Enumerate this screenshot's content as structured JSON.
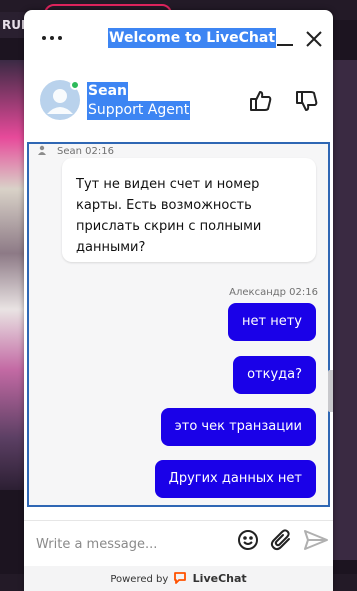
{
  "background": {
    "currency_label": "RUB"
  },
  "widget": {
    "title": "Welcome to LiveChat",
    "agent": {
      "name": "Sean",
      "role": "Support Agent",
      "status_color": "#2dba5a"
    },
    "messages": [
      {
        "sender": "Sean",
        "time": "Sean 02:16",
        "text": "Тут не виден счет и номер карты. Есть возможность прислать скрин с полными данными?"
      }
    ],
    "user_meta": "Александр 02:16",
    "user_messages": [
      "нет нету",
      "откуда?",
      "это чек транзации",
      "Других данных нет"
    ],
    "input_placeholder": "Write a message...",
    "footer": {
      "powered_by": "Powered by",
      "brand": "LiveChat"
    },
    "colors": {
      "title_highlight": "#3d85f3",
      "user_bubble": "#1a01e8",
      "brand_orange": "#ff5100"
    }
  }
}
